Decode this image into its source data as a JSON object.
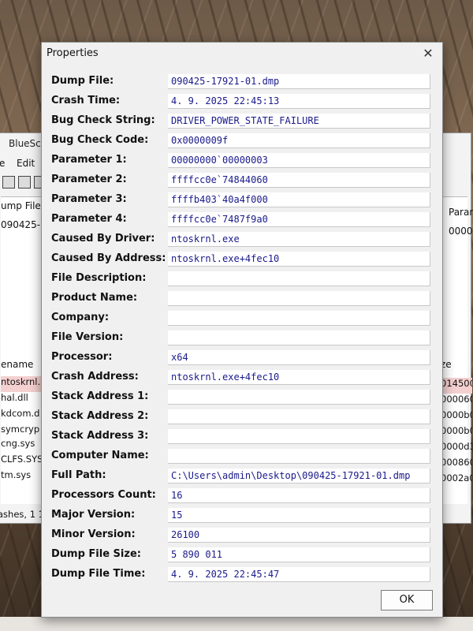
{
  "background_window": {
    "title": "BlueScr",
    "menu": [
      "e",
      "Edit"
    ],
    "upper_columns": [
      "ump File",
      "Paran"
    ],
    "upper_row": [
      "090425-1",
      "00000"
    ],
    "lower_column_left": "ename",
    "lower_column_right": "ze",
    "lower_rows_left": [
      "ntoskrnl.",
      "hal.dll",
      "kdcom.d",
      "symcryp",
      "cng.sys",
      "CLFS.SYS",
      "tm.sys"
    ],
    "lower_rows_right": [
      "014500",
      "000060",
      "0000b0",
      "0000b0",
      "0000d30",
      "000860",
      "0002a0"
    ],
    "status": "ashes, 1 1"
  },
  "dialog": {
    "title": "Properties",
    "close_icon": "close-icon",
    "ok_label": "OK",
    "fields": [
      {
        "label": "Dump File:",
        "value": "090425-17921-01.dmp"
      },
      {
        "label": "Crash Time:",
        "value": "4. 9. 2025 22:45:13"
      },
      {
        "label": "Bug Check String:",
        "value": "DRIVER_POWER_STATE_FAILURE"
      },
      {
        "label": "Bug Check Code:",
        "value": "0x0000009f"
      },
      {
        "label": "Parameter 1:",
        "value": "00000000`00000003"
      },
      {
        "label": "Parameter 2:",
        "value": "ffffcc0e`74844060"
      },
      {
        "label": "Parameter 3:",
        "value": "ffffb403`40a4f000"
      },
      {
        "label": "Parameter 4:",
        "value": "ffffcc0e`7487f9a0"
      },
      {
        "label": "Caused By Driver:",
        "value": "ntoskrnl.exe"
      },
      {
        "label": "Caused By Address:",
        "value": "ntoskrnl.exe+4fec10"
      },
      {
        "label": "File Description:",
        "value": ""
      },
      {
        "label": "Product Name:",
        "value": ""
      },
      {
        "label": "Company:",
        "value": ""
      },
      {
        "label": "File Version:",
        "value": ""
      },
      {
        "label": "Processor:",
        "value": "x64"
      },
      {
        "label": "Crash Address:",
        "value": "ntoskrnl.exe+4fec10"
      },
      {
        "label": "Stack Address 1:",
        "value": ""
      },
      {
        "label": "Stack Address 2:",
        "value": ""
      },
      {
        "label": "Stack Address 3:",
        "value": ""
      },
      {
        "label": "Computer Name:",
        "value": ""
      },
      {
        "label": "Full Path:",
        "value": "C:\\Users\\admin\\Desktop\\090425-17921-01.dmp"
      },
      {
        "label": "Processors Count:",
        "value": "16"
      },
      {
        "label": "Major Version:",
        "value": "15"
      },
      {
        "label": "Minor Version:",
        "value": "26100"
      },
      {
        "label": "Dump File Size:",
        "value": "5 890 011"
      },
      {
        "label": "Dump File Time:",
        "value": "4. 9. 2025 22:45:47"
      }
    ]
  }
}
